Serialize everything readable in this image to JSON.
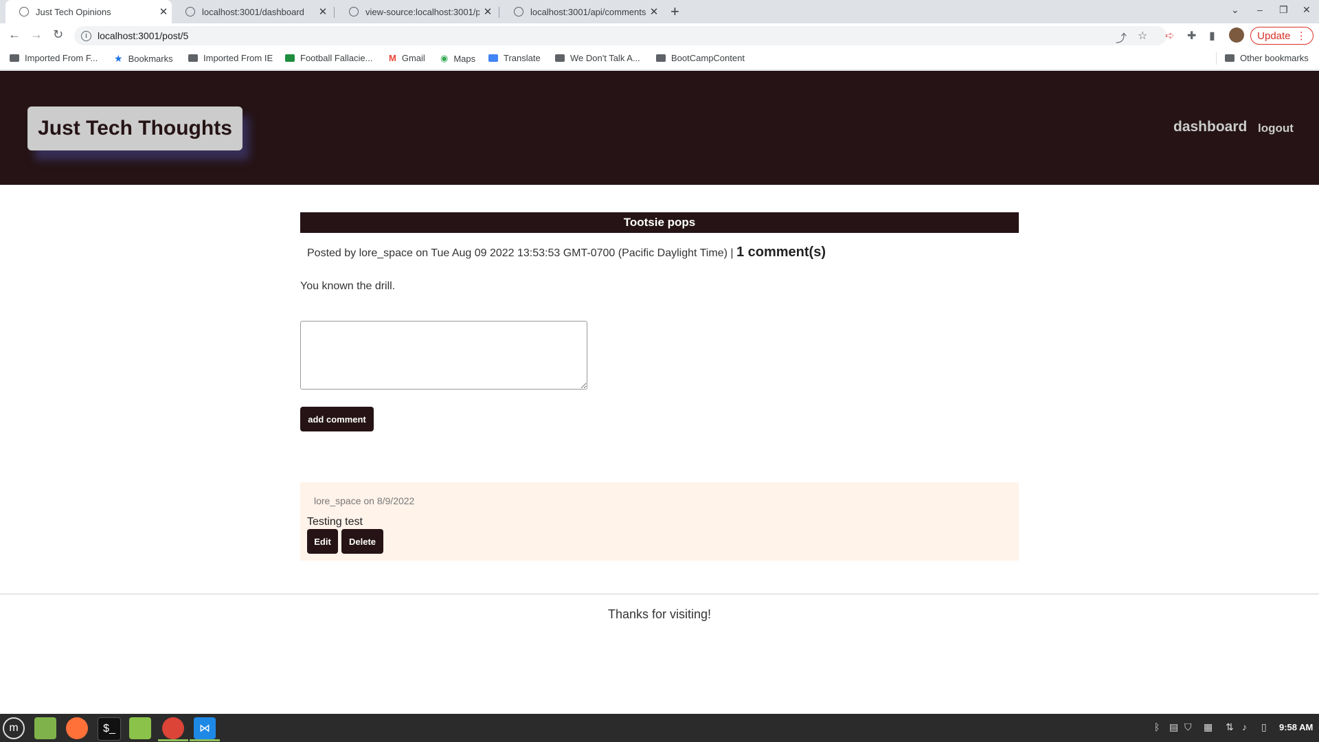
{
  "browser": {
    "tabs": [
      {
        "title": "Just Tech Opinions",
        "active": true
      },
      {
        "title": "localhost:3001/dashboard",
        "active": false
      },
      {
        "title": "view-source:localhost:3001/p",
        "active": false
      },
      {
        "title": "localhost:3001/api/comments",
        "active": false
      }
    ],
    "url": "localhost:3001/post/5",
    "update_label": "Update",
    "bookmarks": [
      {
        "label": "Imported From F...",
        "icon": "folder-icon"
      },
      {
        "label": "Bookmarks",
        "icon": "star-icon"
      },
      {
        "label": "Imported From IE",
        "icon": "folder-icon"
      },
      {
        "label": "Football Fallacie...",
        "icon": "site-icon"
      },
      {
        "label": "Gmail",
        "icon": "gmail-icon"
      },
      {
        "label": "Maps",
        "icon": "maps-icon"
      },
      {
        "label": "Translate",
        "icon": "translate-icon"
      },
      {
        "label": "We Don't Talk A...",
        "icon": "folder-icon"
      },
      {
        "label": "BootCampContent",
        "icon": "folder-icon"
      }
    ],
    "other_bookmarks": "Other bookmarks"
  },
  "header": {
    "brand": "Just Tech Thoughts",
    "nav_dashboard": "dashboard",
    "nav_logout": "logout"
  },
  "post": {
    "title": "Tootsie pops",
    "meta_prefix": "Posted by lore_space on Tue Aug 09 2022 13:53:53 GMT-0700 (Pacific Daylight Time) |",
    "comment_count": "1 comment(s)",
    "body": "You known the drill.",
    "add_comment_label": "add comment"
  },
  "comments": [
    {
      "meta": "lore_space on 8/9/2022",
      "text": "Testing test",
      "edit_label": "Edit",
      "delete_label": "Delete"
    }
  ],
  "footer": {
    "text": "Thanks for visiting!"
  },
  "taskbar": {
    "clock": "9:58 AM"
  },
  "colors": {
    "header_bg": "#251315",
    "comment_bg": "#fff3ea",
    "brand_bg": "#cccccc",
    "update_red": "#d93025"
  }
}
